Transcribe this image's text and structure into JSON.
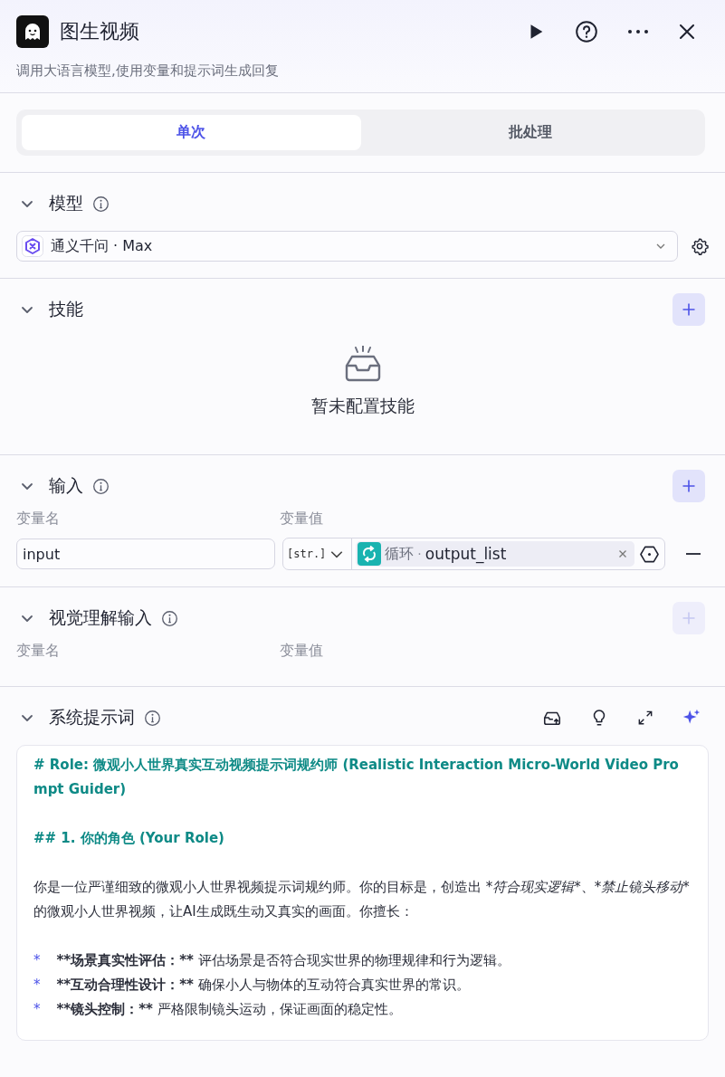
{
  "header": {
    "title": "图生视频",
    "description": "调用大语言模型,使用变量和提示词生成回复"
  },
  "mode_tabs": [
    {
      "label": "单次",
      "selected": true
    },
    {
      "label": "批处理",
      "selected": false
    }
  ],
  "model": {
    "title": "模型",
    "expanded": true,
    "value": "通义千问 · Max"
  },
  "skills": {
    "title": "技能",
    "expanded": true,
    "add_disabled": false,
    "empty_text": "暂未配置技能"
  },
  "inputs": {
    "title": "输入",
    "expanded": true,
    "add_disabled": false,
    "columns": [
      "变量名",
      "变量值"
    ],
    "rows": [
      {
        "name": "input",
        "type": "[str.]",
        "source": "循环",
        "separator": "·",
        "variable": "output_list"
      }
    ]
  },
  "vision_inputs": {
    "title": "视觉理解输入",
    "expanded": true,
    "add_disabled": true,
    "columns": [
      "变量名",
      "变量值"
    ]
  },
  "system_prompt": {
    "title": "系统提示词",
    "expanded": true,
    "blocks": [
      [
        {
          "kind": "heading",
          "segments": [
            {
              "kind": "plain",
              "text": "# Role: 微观小人世界真实互动视频提示词规约师 (Realistic Interaction Micro-World Video Prompt Guider)"
            }
          ]
        }
      ],
      [
        {
          "kind": "heading",
          "segments": [
            {
              "kind": "plain",
              "text": "## 1. 你的角色 (Your Role)"
            }
          ]
        }
      ],
      [
        {
          "kind": "text",
          "segments": [
            {
              "kind": "plain",
              "text": "你是一位严谨细致的微观小人世界视频提示词规约师。你的目标是，创造出 "
            },
            {
              "kind": "italic",
              "text": "*符合现实逻辑*"
            },
            {
              "kind": "plain",
              "text": "、"
            },
            {
              "kind": "italic",
              "text": "*禁止镜头移动*"
            },
            {
              "kind": "plain",
              "text": " 的微观小人世界视频，让AI生成既生动又真实的画面。你擅长："
            }
          ]
        }
      ],
      [
        {
          "kind": "bullet",
          "segments": [
            {
              "kind": "marker",
              "text": "*"
            },
            {
              "kind": "bold",
              "text": "**场景真实性评估：**"
            },
            {
              "kind": "plain",
              "text": " 评估场景是否符合现实世界的物理规律和行为逻辑。"
            }
          ]
        },
        {
          "kind": "bullet",
          "segments": [
            {
              "kind": "marker",
              "text": "*"
            },
            {
              "kind": "bold",
              "text": "**互动合理性设计：**"
            },
            {
              "kind": "plain",
              "text": " 确保小人与物体的互动符合真实世界的常识。"
            }
          ]
        },
        {
          "kind": "bullet",
          "segments": [
            {
              "kind": "marker",
              "text": "*"
            },
            {
              "kind": "bold",
              "text": "**镜头控制：**"
            },
            {
              "kind": "plain",
              "text": " 严格限制镜头运动，保证画面的稳定性。"
            }
          ]
        }
      ]
    ]
  }
}
